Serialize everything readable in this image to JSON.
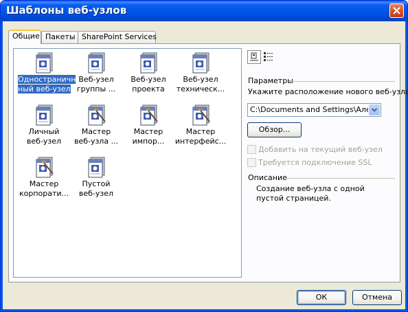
{
  "window": {
    "title": "Шаблоны веб-узлов"
  },
  "tabs": [
    {
      "label": "Общие",
      "active": true
    },
    {
      "label": "Пакеты",
      "active": false
    },
    {
      "label": "SharePoint Services",
      "active": false
    }
  ],
  "templates": [
    {
      "label": "Одностраничный веб-узел",
      "line1": "Одностраничн",
      "line2": "ный веб-узел",
      "icon": "web-page-icon",
      "selected": true
    },
    {
      "label": "Веб-узел группы",
      "line1": "Веб-узел",
      "line2": "группы ...",
      "icon": "web-page-icon",
      "selected": false
    },
    {
      "label": "Веб-узел проекта",
      "line1": "Веб-узел",
      "line2": "проекта",
      "icon": "web-page-icon",
      "selected": false
    },
    {
      "label": "Веб-узел технической поддержки",
      "line1": "Веб-узел",
      "line2": "техническ...",
      "icon": "web-page-icon",
      "selected": false
    },
    {
      "label": "Личный веб-узел",
      "line1": "Личный",
      "line2": "веб-узел",
      "icon": "web-page-icon",
      "selected": false
    },
    {
      "label": "Мастер веб-узла",
      "line1": "Мастер",
      "line2": "веб-узла ...",
      "icon": "wizard-icon",
      "selected": false
    },
    {
      "label": "Мастер импорта",
      "line1": "Мастер",
      "line2": "импор...",
      "icon": "wizard-icon",
      "selected": false
    },
    {
      "label": "Мастер интерфейса",
      "line1": "Мастер",
      "line2": "интерфейс...",
      "icon": "wizard-icon",
      "selected": false
    },
    {
      "label": "Мастер корпоративного",
      "line1": "Мастер",
      "line2": "корпорати...",
      "icon": "wizard-icon",
      "selected": false
    },
    {
      "label": "Пустой веб-узел",
      "line1": "Пустой",
      "line2": "веб-узел",
      "icon": "web-page-icon",
      "selected": false
    }
  ],
  "view_buttons": [
    {
      "name": "large-icons-view-icon",
      "active": true
    },
    {
      "name": "details-view-icon",
      "active": false
    }
  ],
  "parameters": {
    "heading": "Параметры",
    "location_label": "Укажите расположение нового веб-узла:",
    "location_value": "C:\\Documents and Settings\\Алексе",
    "browse_label": "Обзор...",
    "add_to_current_label": "Добавить на текущий веб-узел",
    "add_to_current_checked": false,
    "ssl_label": "Требуется подключение SSL",
    "ssl_checked": false
  },
  "description": {
    "heading": "Описание",
    "text": "Создание веб-узла с одной пустой страницей."
  },
  "footer": {
    "ok_label": "ОК",
    "cancel_label": "Отмена"
  },
  "colors": {
    "titlebar": "#0054e3",
    "selection": "#316ac5",
    "close_button": "#d6552a",
    "dialog_bg": "#ece9d8"
  }
}
